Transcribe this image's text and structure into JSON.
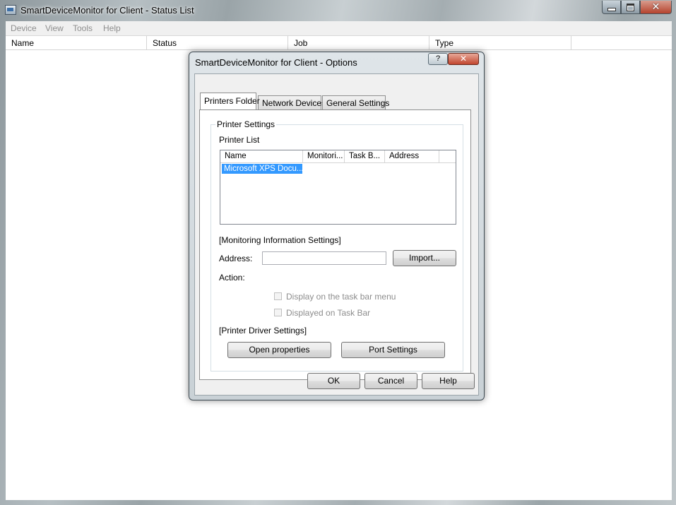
{
  "main_window": {
    "title": "SmartDeviceMonitor for Client - Status List",
    "controls": {
      "minimize": "minimize",
      "maximize": "maximize",
      "close": "✕"
    }
  },
  "menubar": {
    "items": [
      "Device",
      "View",
      "Tools",
      "Help"
    ]
  },
  "status_list": {
    "columns": [
      "Name",
      "Status",
      "Job",
      "Type"
    ]
  },
  "dialog": {
    "title": "SmartDeviceMonitor for Client - Options",
    "help_glyph": "?",
    "close_glyph": "✕",
    "tabs": [
      "Printers Folder",
      "Network Devices",
      "General Settings"
    ],
    "active_tab": "Printers Folder",
    "printer_settings": {
      "group_label": "Printer Settings",
      "printer_list_label": "Printer List",
      "columns": [
        "Name",
        "Monitori...",
        "Task B...",
        "Address"
      ],
      "rows": [
        {
          "name": "Microsoft XPS Docu...",
          "selected": true
        }
      ]
    },
    "monitoring": {
      "section_label": "[Monitoring Information Settings]",
      "address_label": "Address:",
      "address_value": "",
      "import_button": "Import...",
      "action_label": "Action:",
      "checkbox_taskbar_menu": "Display on the task bar menu",
      "checkbox_taskbar": "Displayed on Task Bar"
    },
    "driver": {
      "section_label": "[Printer Driver Settings]",
      "open_properties_button": "Open properties",
      "port_settings_button": "Port Settings"
    },
    "footer": {
      "ok": "OK",
      "cancel": "Cancel",
      "help": "Help"
    }
  },
  "colors": {
    "selection": "#3399ff",
    "close_button": "#c1462e",
    "disabled_text": "#8d8d8d"
  }
}
